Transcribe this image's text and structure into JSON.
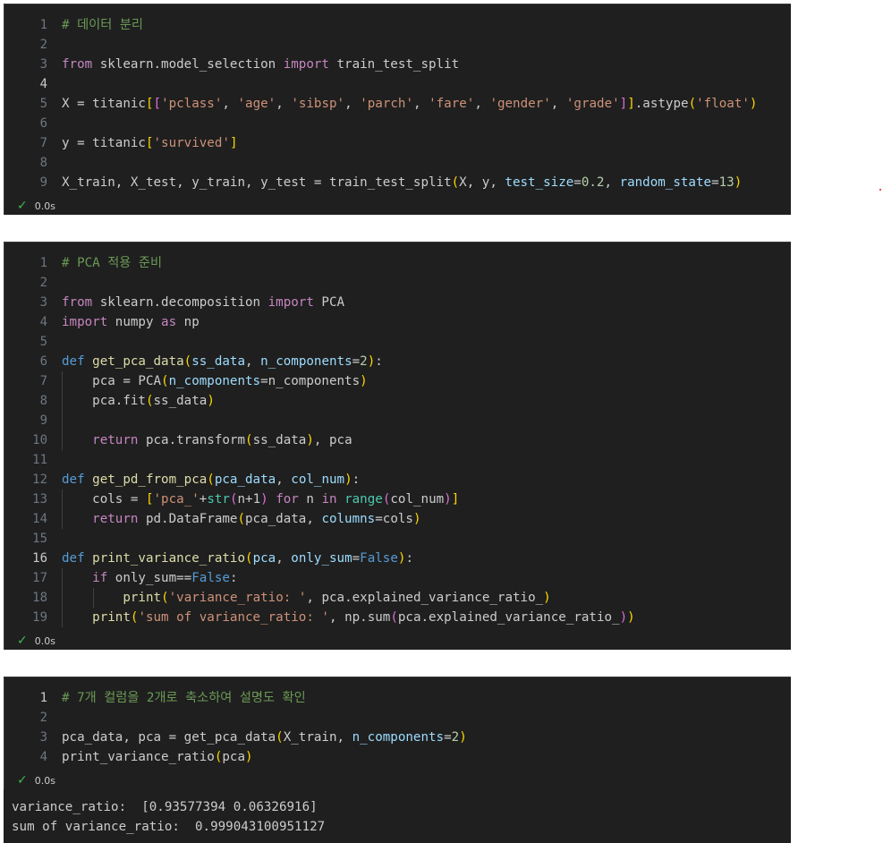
{
  "cells": [
    {
      "status": "0.0s",
      "lines": [
        {
          "n": "1",
          "active": false,
          "tokens": [
            [
              "cm",
              "# 데이터 분리"
            ]
          ]
        },
        {
          "n": "2",
          "active": false,
          "tokens": []
        },
        {
          "n": "3",
          "active": false,
          "tokens": [
            [
              "kw",
              "from"
            ],
            [
              "",
              " sklearn.model_selection "
            ],
            [
              "kw",
              "import"
            ],
            [
              "",
              " train_test_split"
            ]
          ]
        },
        {
          "n": "4",
          "active": true,
          "tokens": []
        },
        {
          "n": "5",
          "active": false,
          "tokens": [
            [
              "",
              "X = titanic"
            ],
            [
              "br1",
              "["
            ],
            [
              "br2",
              "["
            ],
            [
              "st",
              "'pclass'"
            ],
            [
              "",
              ", "
            ],
            [
              "st",
              "'age'"
            ],
            [
              "",
              ", "
            ],
            [
              "st",
              "'sibsp'"
            ],
            [
              "",
              ", "
            ],
            [
              "st",
              "'parch'"
            ],
            [
              "",
              ", "
            ],
            [
              "st",
              "'fare'"
            ],
            [
              "",
              ", "
            ],
            [
              "st",
              "'gender'"
            ],
            [
              "",
              ", "
            ],
            [
              "st",
              "'grade'"
            ],
            [
              "br2",
              "]"
            ],
            [
              "br1",
              "]"
            ],
            [
              "",
              ".astype"
            ],
            [
              "br1",
              "("
            ],
            [
              "st",
              "'float'"
            ],
            [
              "br1",
              ")"
            ]
          ]
        },
        {
          "n": "6",
          "active": false,
          "tokens": []
        },
        {
          "n": "7",
          "active": false,
          "tokens": [
            [
              "",
              "y = titanic"
            ],
            [
              "br1",
              "["
            ],
            [
              "st",
              "'survived'"
            ],
            [
              "br1",
              "]"
            ]
          ]
        },
        {
          "n": "8",
          "active": false,
          "tokens": []
        },
        {
          "n": "9",
          "active": false,
          "tokens": [
            [
              "",
              "X_train, X_test, y_train, y_test = train_test_split"
            ],
            [
              "br1",
              "("
            ],
            [
              "",
              "X, y, "
            ],
            [
              "pa",
              "test_size"
            ],
            [
              "",
              "="
            ],
            [
              "nu",
              "0.2"
            ],
            [
              "",
              ", "
            ],
            [
              "pa",
              "random_state"
            ],
            [
              "",
              "="
            ],
            [
              "nu",
              "13"
            ],
            [
              "br1",
              ")"
            ]
          ]
        }
      ]
    },
    {
      "status": "0.0s",
      "lines": [
        {
          "n": "1",
          "active": false,
          "tokens": [
            [
              "cm",
              "# PCA 적용 준비"
            ]
          ]
        },
        {
          "n": "2",
          "active": false,
          "tokens": []
        },
        {
          "n": "3",
          "active": false,
          "tokens": [
            [
              "kw",
              "from"
            ],
            [
              "",
              " sklearn.decomposition "
            ],
            [
              "kw",
              "import"
            ],
            [
              "",
              " PCA"
            ]
          ]
        },
        {
          "n": "4",
          "active": false,
          "tokens": [
            [
              "kw",
              "import"
            ],
            [
              "",
              " numpy "
            ],
            [
              "kw",
              "as"
            ],
            [
              "",
              " np"
            ]
          ]
        },
        {
          "n": "5",
          "active": false,
          "tokens": []
        },
        {
          "n": "6",
          "active": false,
          "tokens": [
            [
              "kb",
              "def"
            ],
            [
              "",
              " "
            ],
            [
              "fn",
              "get_pca_data"
            ],
            [
              "br1",
              "("
            ],
            [
              "pa",
              "ss_data"
            ],
            [
              "",
              ", "
            ],
            [
              "pa",
              "n_components"
            ],
            [
              "",
              "="
            ],
            [
              "nu",
              "2"
            ],
            [
              "br1",
              ")"
            ],
            [
              "",
              ":"
            ]
          ]
        },
        {
          "n": "7",
          "active": false,
          "tokens": [
            [
              "",
              "    pca = PCA"
            ],
            [
              "br1",
              "("
            ],
            [
              "pa",
              "n_components"
            ],
            [
              "",
              "=n_components"
            ],
            [
              "br1",
              ")"
            ]
          ]
        },
        {
          "n": "8",
          "active": false,
          "tokens": [
            [
              "",
              "    pca.fit"
            ],
            [
              "br1",
              "("
            ],
            [
              "",
              "ss_data"
            ],
            [
              "br1",
              ")"
            ]
          ]
        },
        {
          "n": "9",
          "active": false,
          "tokens": []
        },
        {
          "n": "10",
          "active": false,
          "tokens": [
            [
              "",
              "    "
            ],
            [
              "kw",
              "return"
            ],
            [
              "",
              " pca.transform"
            ],
            [
              "br1",
              "("
            ],
            [
              "",
              "ss_data"
            ],
            [
              "br1",
              ")"
            ],
            [
              "",
              ", pca"
            ]
          ]
        },
        {
          "n": "11",
          "active": false,
          "tokens": []
        },
        {
          "n": "12",
          "active": false,
          "tokens": [
            [
              "kb",
              "def"
            ],
            [
              "",
              " "
            ],
            [
              "fn",
              "get_pd_from_pca"
            ],
            [
              "br1",
              "("
            ],
            [
              "pa",
              "pca_data"
            ],
            [
              "",
              ", "
            ],
            [
              "pa",
              "col_num"
            ],
            [
              "br1",
              ")"
            ],
            [
              "",
              ":"
            ]
          ]
        },
        {
          "n": "13",
          "active": false,
          "tokens": [
            [
              "",
              "    cols = "
            ],
            [
              "br1",
              "["
            ],
            [
              "st",
              "'pca_'"
            ],
            [
              "",
              "+"
            ],
            [
              "bi",
              "str"
            ],
            [
              "br2",
              "("
            ],
            [
              "",
              "n+1"
            ],
            [
              "br2",
              ")"
            ],
            [
              "",
              " "
            ],
            [
              "kw",
              "for"
            ],
            [
              "",
              " n "
            ],
            [
              "kw",
              "in"
            ],
            [
              "",
              " "
            ],
            [
              "bi",
              "range"
            ],
            [
              "br2",
              "("
            ],
            [
              "",
              "col_num"
            ],
            [
              "br2",
              ")"
            ],
            [
              "br1",
              "]"
            ]
          ]
        },
        {
          "n": "14",
          "active": false,
          "tokens": [
            [
              "",
              "    "
            ],
            [
              "kw",
              "return"
            ],
            [
              "",
              " pd.DataFrame"
            ],
            [
              "br1",
              "("
            ],
            [
              "",
              "pca_data, "
            ],
            [
              "pa",
              "columns"
            ],
            [
              "",
              "=cols"
            ],
            [
              "br1",
              ")"
            ]
          ]
        },
        {
          "n": "15",
          "active": false,
          "tokens": []
        },
        {
          "n": "16",
          "active": true,
          "tokens": [
            [
              "kb",
              "def"
            ],
            [
              "",
              " "
            ],
            [
              "fn",
              "print_variance_ratio"
            ],
            [
              "br1",
              "("
            ],
            [
              "pa",
              "pca"
            ],
            [
              "",
              ", "
            ],
            [
              "pa",
              "only_sum"
            ],
            [
              "",
              "="
            ],
            [
              "kb",
              "False"
            ],
            [
              "br1",
              ")"
            ],
            [
              "",
              ":"
            ]
          ]
        },
        {
          "n": "17",
          "active": false,
          "tokens": [
            [
              "",
              "    "
            ],
            [
              "kw",
              "if"
            ],
            [
              "",
              " only_sum=="
            ],
            [
              "kb",
              "False"
            ],
            [
              "",
              ":"
            ]
          ]
        },
        {
          "n": "18",
          "active": false,
          "tokens": [
            [
              "",
              "        "
            ],
            [
              "fn",
              "print"
            ],
            [
              "br1",
              "("
            ],
            [
              "st",
              "'variance_ratio: '"
            ],
            [
              "",
              ", pca.explained_variance_ratio_"
            ],
            [
              "br1",
              ")"
            ]
          ]
        },
        {
          "n": "19",
          "active": false,
          "tokens": [
            [
              "",
              "    "
            ],
            [
              "fn",
              "print"
            ],
            [
              "br1",
              "("
            ],
            [
              "st",
              "'sum of variance_ratio: '"
            ],
            [
              "",
              ", np.sum"
            ],
            [
              "br2",
              "("
            ],
            [
              "",
              "pca.explained_variance_ratio_"
            ],
            [
              "br2",
              ")"
            ],
            [
              "br1",
              ")"
            ]
          ]
        }
      ]
    },
    {
      "status": "0.0s",
      "lines": [
        {
          "n": "1",
          "active": true,
          "tokens": [
            [
              "cm",
              "# 7개 컬럼을 2개로 축소하여 설명도 확인"
            ]
          ]
        },
        {
          "n": "2",
          "active": false,
          "tokens": []
        },
        {
          "n": "3",
          "active": false,
          "tokens": [
            [
              "",
              "pca_data, pca = get_pca_data"
            ],
            [
              "br1",
              "("
            ],
            [
              "",
              "X_train, "
            ],
            [
              "pa",
              "n_components"
            ],
            [
              "",
              "="
            ],
            [
              "nu",
              "2"
            ],
            [
              "br1",
              ")"
            ]
          ]
        },
        {
          "n": "4",
          "active": false,
          "tokens": [
            [
              "",
              "print_variance_ratio"
            ],
            [
              "br1",
              "("
            ],
            [
              "",
              "pca"
            ],
            [
              "br1",
              ")"
            ]
          ]
        }
      ]
    }
  ],
  "output": {
    "line1": "variance_ratio:  [0.93577394 0.06326916]",
    "line2": "sum of variance_ratio:  0.999043100951127"
  },
  "status_icon": "check-icon"
}
